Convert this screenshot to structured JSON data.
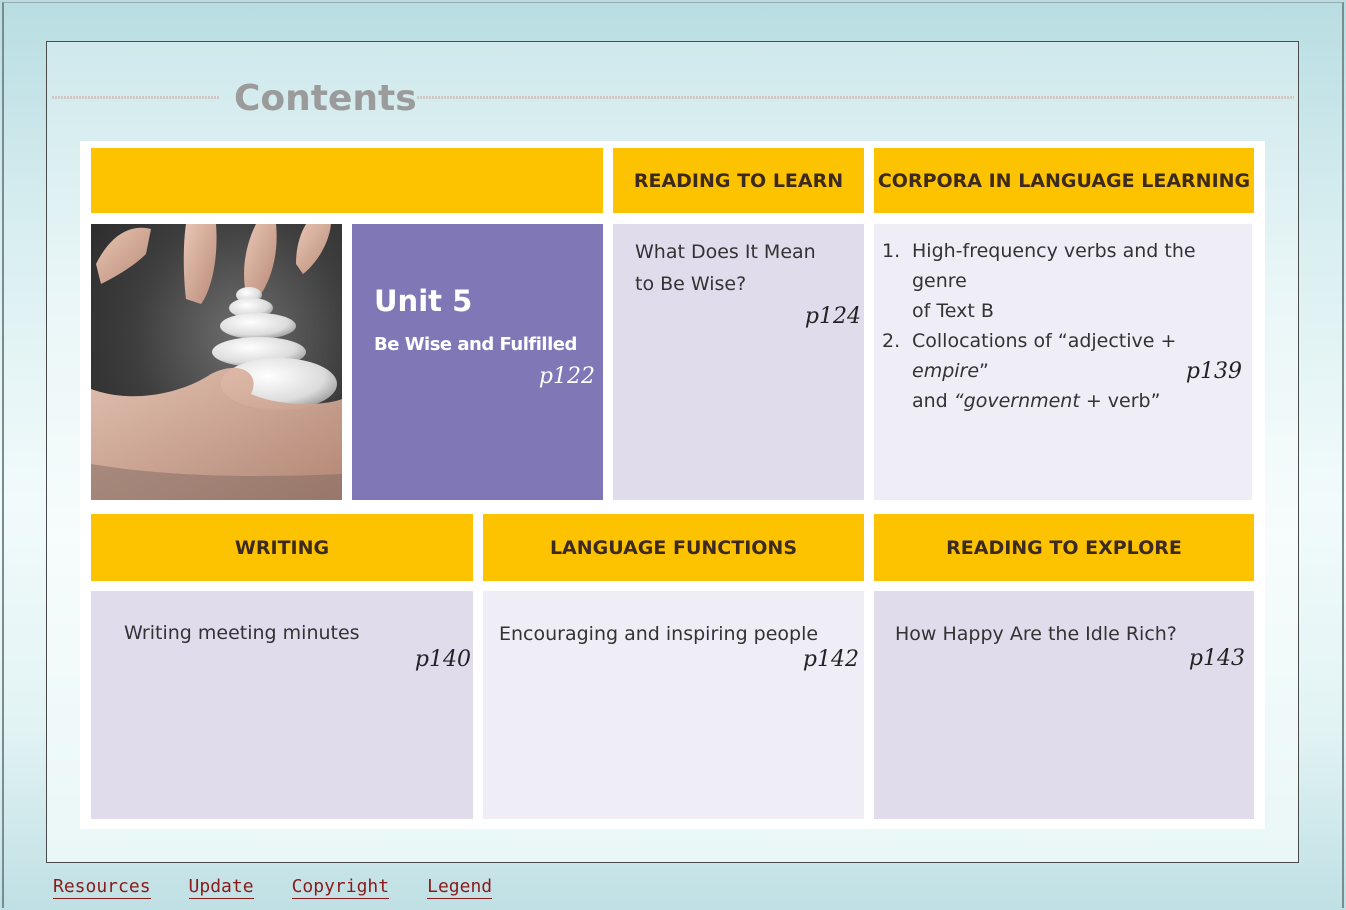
{
  "page": {
    "title": "Contents"
  },
  "header_row": {
    "col1": "",
    "reading_to_learn": "READING TO LEARN",
    "corpora": "CORPORA IN LANGUAGE LEARNING"
  },
  "unit": {
    "title": "Unit 5",
    "subtitle": "Be Wise and Fulfilled",
    "page": "p122"
  },
  "reading_to_learn": {
    "line1": "What Does It Mean",
    "line2": "to Be Wise?",
    "page": "p124"
  },
  "corpora": {
    "items": [
      {
        "num": "1.",
        "text_a": "High-frequency verbs and the genre",
        "text_b": "of Text B"
      },
      {
        "num": "2.",
        "text_a_pre": "Collocations of “adjective + ",
        "text_a_em": "empire",
        "text_a_post": "”",
        "text_b_pre": "and ",
        "text_b_em": "“government",
        "text_b_post": " + verb”"
      }
    ],
    "page": "p139"
  },
  "bottom_headers": {
    "writing": "WRITING",
    "language_functions": "LANGUAGE FUNCTIONS",
    "reading_to_explore": "READING TO EXPLORE"
  },
  "writing": {
    "text": "Writing meeting minutes",
    "page": "p140"
  },
  "language_functions": {
    "text": "Encouraging and inspiring people",
    "page": "p142"
  },
  "reading_to_explore": {
    "text": "How Happy Are the Idle Rich?",
    "page": "p143"
  },
  "footer": {
    "links": [
      "Resources",
      "Update",
      "Copyright",
      "Legend"
    ]
  },
  "colors": {
    "yellow": "#fdc300",
    "purple": "#8077b7",
    "lavender": "#e0dcec",
    "footer_link": "#8b1a1a"
  }
}
